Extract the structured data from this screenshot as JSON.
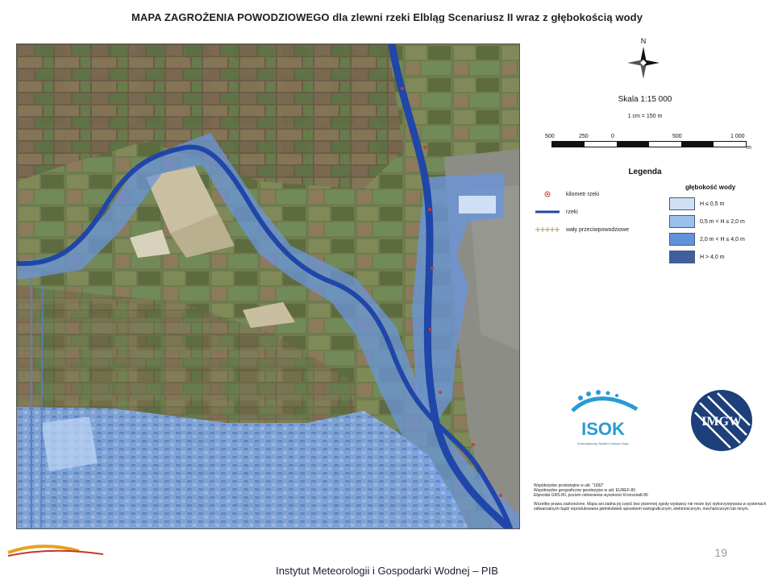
{
  "title": "MAPA ZAGROŻENIA POWODZIOWEGO dla zlewni rzeki Elbląg Scenariusz II wraz z głębokością wody",
  "north_label": "N",
  "scale": {
    "label": "Skala 1:15 000",
    "unit_note": "1 cm = 150 m",
    "ticks": [
      "500",
      "250",
      "0",
      "500",
      "1 000"
    ],
    "unit": "m"
  },
  "legend": {
    "title": "Legenda",
    "items": [
      {
        "label": "kilometr rzeki",
        "symbol": "km-marker"
      },
      {
        "label": "rzeki",
        "symbol": "river-line"
      },
      {
        "label": "wały przeciwpowodziowe",
        "symbol": "levee-line"
      }
    ],
    "depth_title": "głębokość wody",
    "depth_classes": [
      {
        "label": "H ≤ 0,5 m",
        "color": "#cfe0f5"
      },
      {
        "label": "0,5 m < H ≤ 2,0 m",
        "color": "#9cc0ee"
      },
      {
        "label": "2,0 m < H ≤ 4,0 m",
        "color": "#6391dc"
      },
      {
        "label": "H > 4,0 m",
        "color": "#3f5f9e"
      }
    ]
  },
  "logos": {
    "isok": {
      "name": "ISOK",
      "sub": "Informatyczny System Osłony Kraju"
    },
    "imgw": {
      "name": "IMGW"
    }
  },
  "notes": {
    "coords": [
      "Współrzędne prostokątne w ukł. \"1992\"",
      "Współrzędne geograficzne geodezyjne w ukł. EUREF-89",
      "Elipsoida GRS-80, poziom odniesienia wysokości Kronsztadt 86"
    ],
    "rights": "Wszelkie prawa zastrzeżone. Mapa ani żadna jej część bez pisemnej zgody wydawcy nie może być wykorzystywana w systemach odtwarzalnych bądź reprodukowana jakimkolwiek sposobem kartograficznym, elektronicznym, mechanicznym lub innym."
  },
  "slide_number": "19",
  "footer": "Instytut Meteorologii i Gospodarki Wodnej – PIB",
  "colors": {
    "river": "#1f46a8",
    "flood_shallow": "#9cc0ee",
    "flood_deep": "#5a88d6",
    "km_marker": "#d23b2c"
  }
}
